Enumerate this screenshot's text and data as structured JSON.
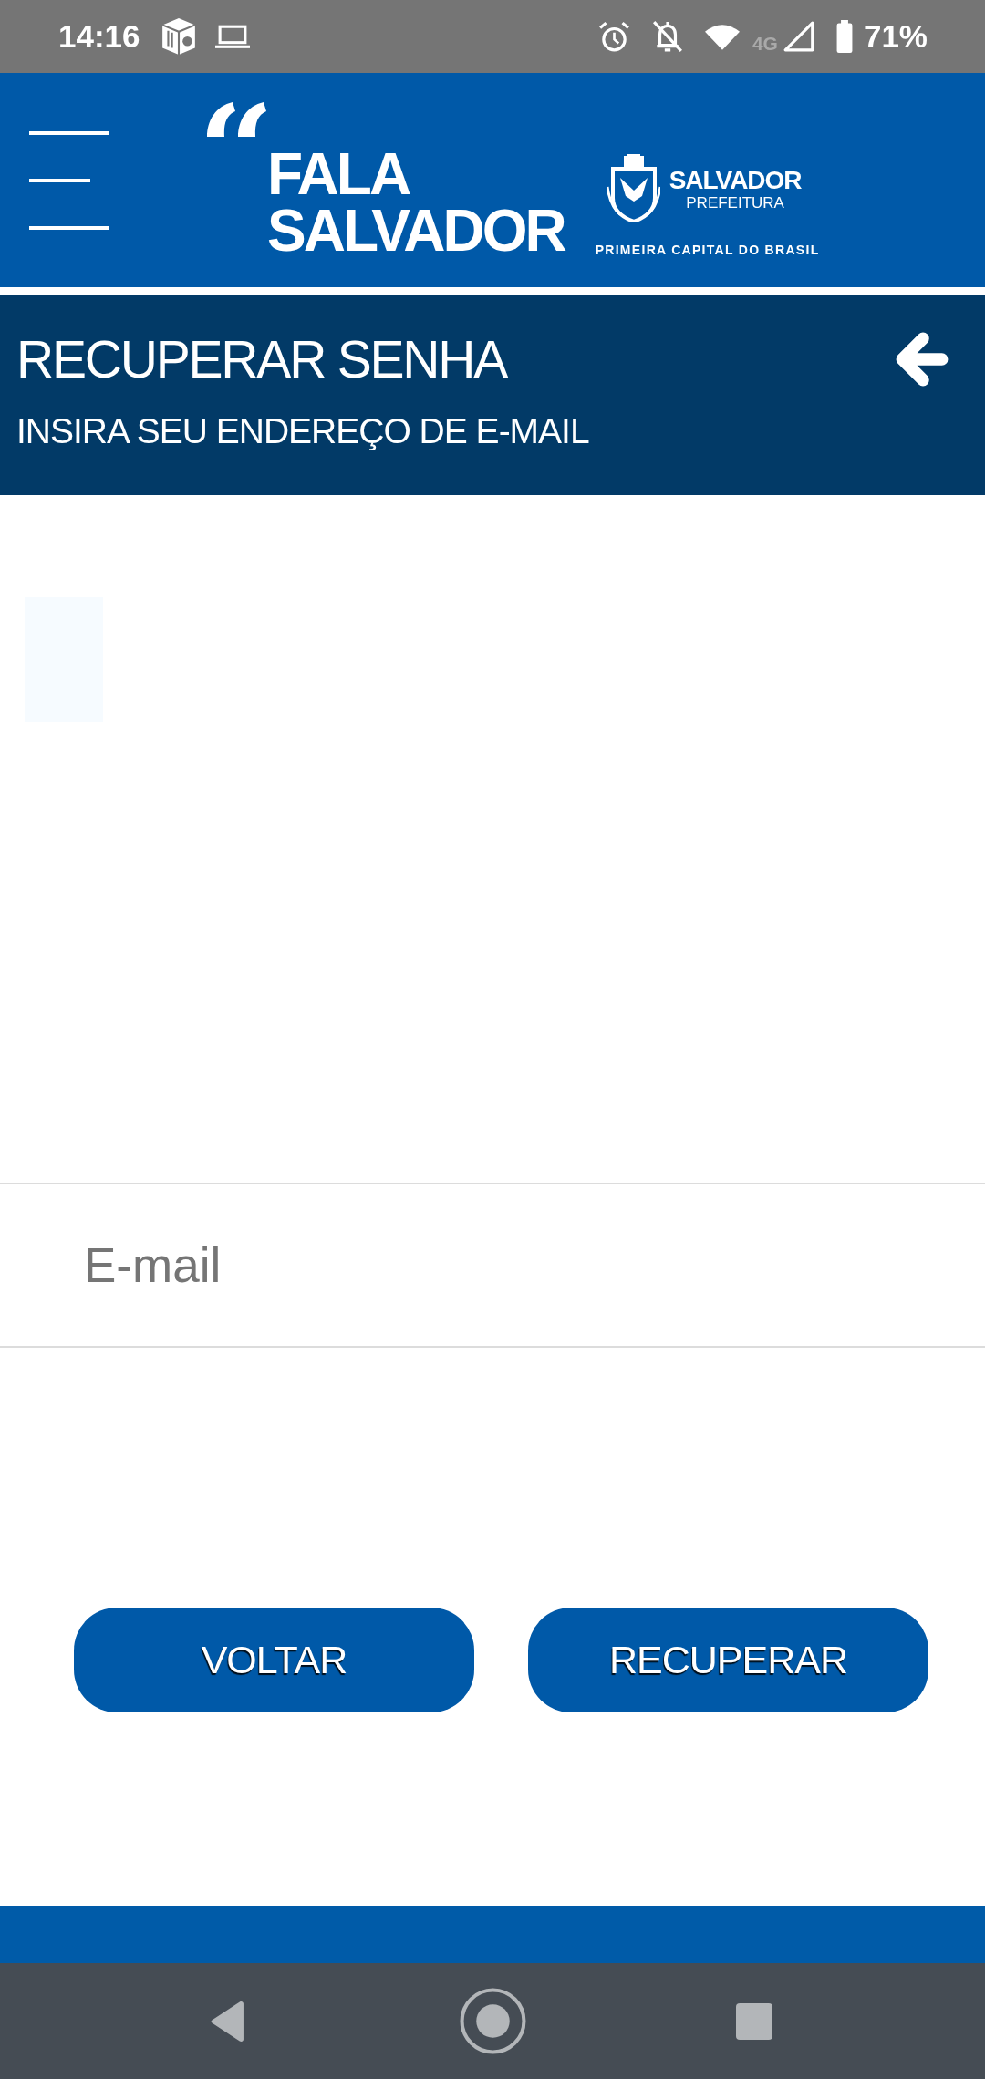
{
  "status_bar": {
    "time": "14:16",
    "network": "4G",
    "battery": "71%"
  },
  "header": {
    "wordmark": [
      "FALA",
      "SALVADOR"
    ],
    "city_logo": {
      "name": "SALVADOR",
      "subtitle": "PREFEITURA",
      "tagline": "PRIMEIRA CAPITAL DO BRASIL"
    }
  },
  "page_header": {
    "title": "RECUPERAR SENHA",
    "subtitle": "INSIRA SEU ENDEREÇO DE E-MAIL"
  },
  "form": {
    "email": {
      "placeholder": "E-mail"
    }
  },
  "buttons": [
    {
      "label": "VOLTAR"
    },
    {
      "label": "RECUPERAR"
    }
  ]
}
